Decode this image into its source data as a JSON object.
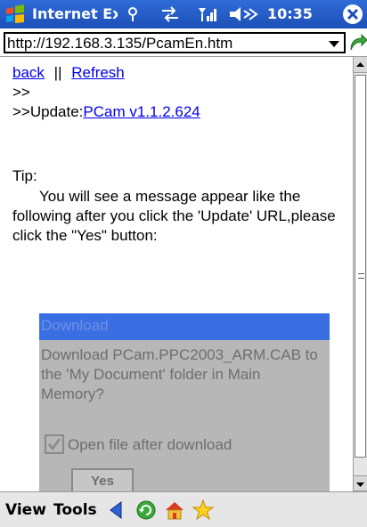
{
  "titlebar": {
    "title": "Internet Ex",
    "time": "10:35",
    "icons": [
      "windows-start-icon",
      "connectivity-icon",
      "sync-icon",
      "signal-icon",
      "volume-icon",
      "close-icon"
    ]
  },
  "address": {
    "url": "http://192.168.3.135/PcamEn.htm"
  },
  "page": {
    "back_label": "back",
    "separator": "||",
    "refresh_label": "Refresh",
    "line1": ">>",
    "update_prefix": ">>Update:",
    "update_link": "PCam v1.1.2.624",
    "tip_heading": "Tip:",
    "tip_text": "You will see a message appear like the following after you click the 'Update' URL,please click the \"Yes\" button:"
  },
  "dialog": {
    "title": "Download",
    "message": "Download PCam.PPC2003_ARM.CAB to the 'My Document' folder in Main Memory?",
    "checkbox_label": "Open file after download",
    "checkbox_checked": true,
    "yes_label": "Yes"
  },
  "menubar": {
    "view_label": "View",
    "tools_label": "Tools",
    "toolbar_icons": [
      "back-arrow-icon",
      "refresh-icon",
      "home-icon",
      "favorites-icon"
    ]
  },
  "colors": {
    "titlebar": "#1d4fb8",
    "link": "#0000ee",
    "dialog_title": "#3a6fe4"
  }
}
